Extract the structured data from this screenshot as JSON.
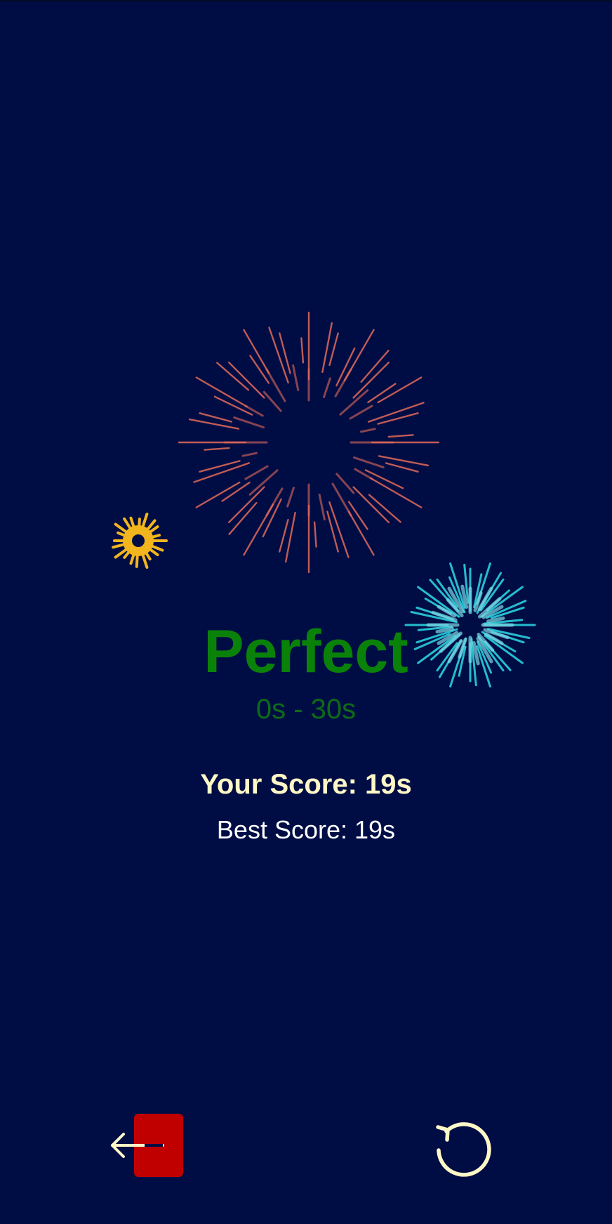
{
  "result": {
    "rating": "Perfect",
    "range": "0s - 30s"
  },
  "scores": {
    "your_score": "Your Score: 19s",
    "best_score": "Best Score: 19s"
  },
  "controls": {
    "exit_icon": "exit-door-arrow-icon",
    "replay_icon": "restart-icon"
  },
  "colors": {
    "background": "#000d45",
    "rating": "#0a820a",
    "your_score": "#fff8c6",
    "exit_door": "#c00000",
    "firework_red": "#e26a5a",
    "firework_yellow": "#f2b51d",
    "firework_cyan": "#27c6d6"
  }
}
